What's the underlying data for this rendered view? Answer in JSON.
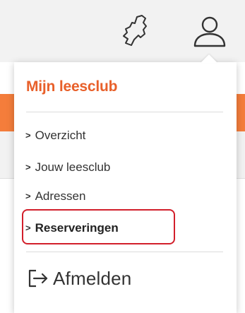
{
  "header": {
    "icons": [
      "map-netherlands-icon",
      "user-account-icon"
    ]
  },
  "menu": {
    "title": "Mijn leesclub",
    "items": [
      {
        "label": "Overzicht"
      },
      {
        "label": "Jouw leesclub"
      },
      {
        "label": "Adressen"
      },
      {
        "label": "Reserveringen",
        "highlighted": true
      }
    ],
    "logout_label": "Afmelden"
  },
  "colors": {
    "accent": "#e8602a",
    "band": "#f47d3b",
    "highlight": "#d21f2b"
  }
}
